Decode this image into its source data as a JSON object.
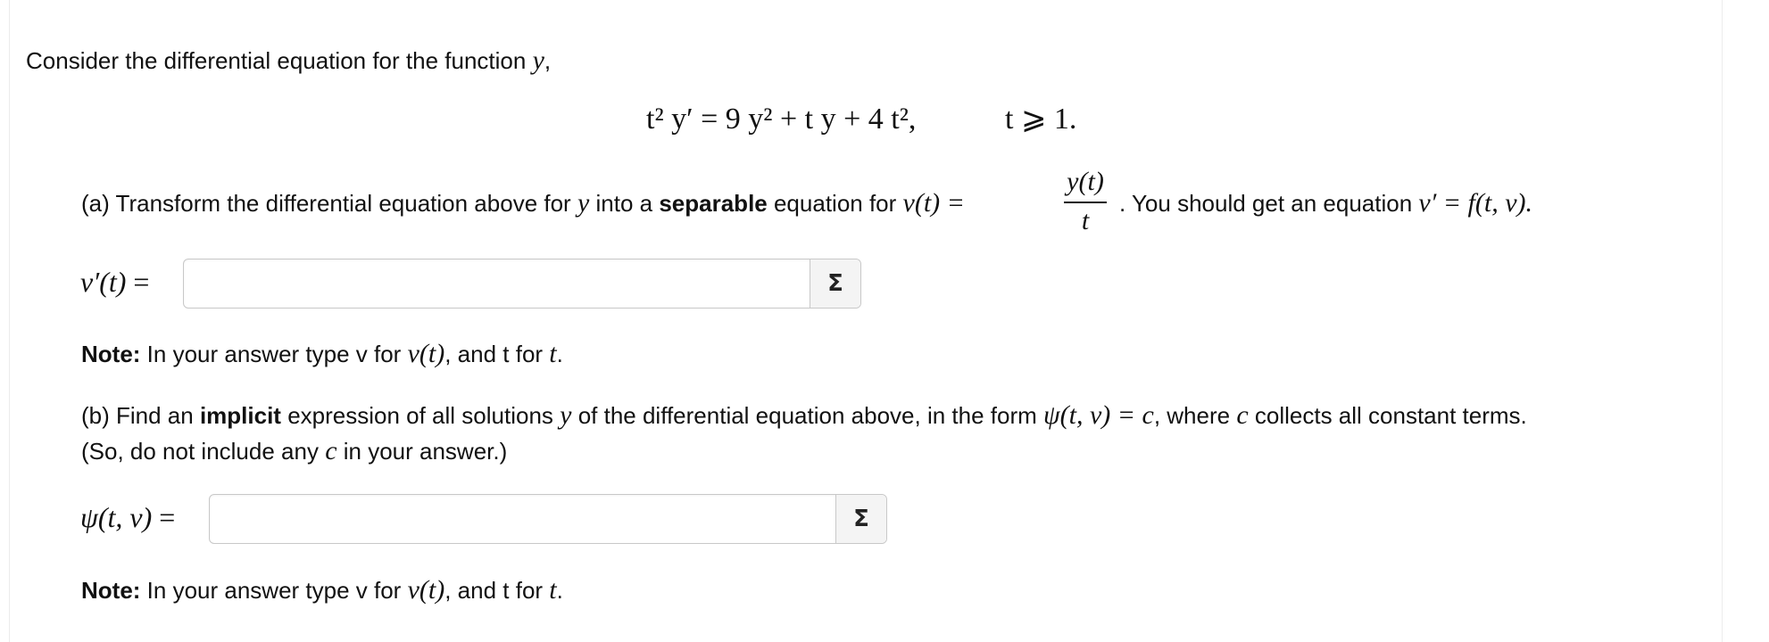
{
  "intro": {
    "text": "Consider the differential equation for the function ",
    "var": "y",
    "tail": ","
  },
  "equation": {
    "main": "t² y′ = 9 y² + t y + 4 t²,",
    "condition": "t ⩾ 1."
  },
  "part_a": {
    "prefix": "(a) Transform the differential equation above for ",
    "var_y": "y",
    "into": " into a ",
    "bold": "separable",
    "suffix": " equation for ",
    "v_t": "v(t) =",
    "frac_num": "y(t)",
    "frac_den": "t",
    "after": ". You should get an equation ",
    "form": "v′ = f(t, v).",
    "answer_label": "v′(t)",
    "answer_eq": "=",
    "answer_value": "",
    "sigma": "Σ"
  },
  "note_a": {
    "bold": "Note:",
    "text1": " In your answer type v for ",
    "v_t": "v(t)",
    "text2": ", and t for ",
    "t": "t",
    "end": "."
  },
  "part_b": {
    "prefix": "(b) Find an ",
    "bold": "implicit",
    "mid1": " expression of all solutions ",
    "var_y": "y",
    "mid2": " of the differential equation above, in the form ",
    "form": "ψ(t, v) = c",
    "mid3": ", where ",
    "c": "c",
    "tail": " collects all constant terms.",
    "line2_pre": "(So, do not include any ",
    "line2_c": "c",
    "line2_post": " in your answer.)",
    "answer_label": "ψ(t, v)",
    "answer_eq": "=",
    "answer_value": "",
    "sigma": "Σ"
  },
  "note_b": {
    "bold": "Note:",
    "text1": " In your answer type v for ",
    "v_t": "v(t)",
    "text2": ", and t for ",
    "t": "t",
    "end": "."
  }
}
